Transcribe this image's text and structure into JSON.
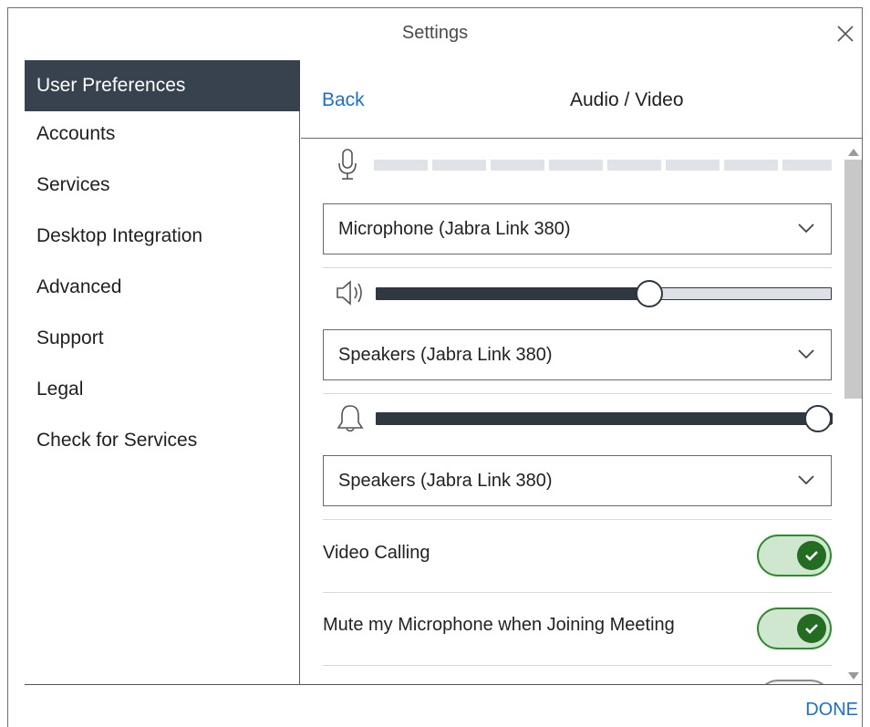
{
  "window": {
    "title": "Settings",
    "close_icon": "close-icon"
  },
  "sidebar": {
    "items": [
      {
        "label": "User Preferences",
        "active": true
      },
      {
        "label": "Accounts",
        "active": false
      },
      {
        "label": "Services",
        "active": false
      },
      {
        "label": "Desktop Integration",
        "active": false
      },
      {
        "label": "Advanced",
        "active": false
      },
      {
        "label": "Support",
        "active": false
      },
      {
        "label": "Legal",
        "active": false
      },
      {
        "label": "Check for Services",
        "active": false
      }
    ]
  },
  "panel": {
    "back_label": "Back",
    "title": "Audio / Video",
    "microphone": {
      "icon": "microphone-icon",
      "level_segments": 8,
      "level": 0,
      "device": "Microphone (Jabra Link 380)"
    },
    "speaker": {
      "icon": "speaker-volume-icon",
      "volume_percent": 60,
      "device": "Speakers (Jabra Link 380)"
    },
    "ringer": {
      "icon": "bell-icon",
      "volume_percent": 100,
      "device": "Speakers (Jabra Link 380)"
    },
    "toggles": [
      {
        "label": "Video Calling",
        "on": true
      },
      {
        "label": "Mute my Microphone when Joining Meeting",
        "on": true
      }
    ]
  },
  "footer": {
    "done_label": "DONE"
  },
  "colors": {
    "accent": "#1a6fd6",
    "sidebar_active_bg": "#38424f",
    "toggle_on": "#236d23",
    "slider": "#2f3740"
  }
}
